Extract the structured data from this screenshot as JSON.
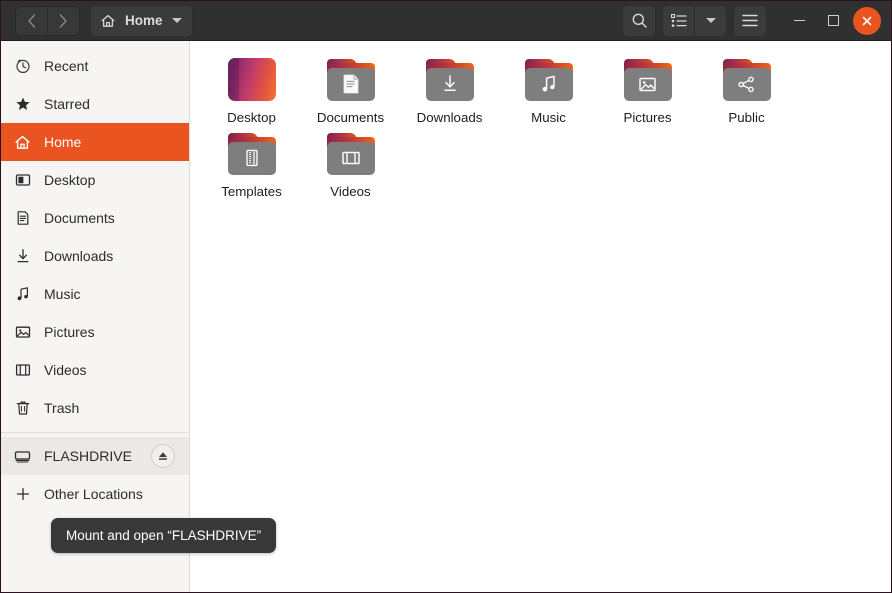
{
  "window": {
    "title": "Home",
    "titlebar": {
      "back_tooltip": "Back",
      "forward_tooltip": "Forward",
      "path_label": "Home",
      "path_icon": "home-icon",
      "search_icon": "search-icon",
      "view_list_icon": "list-view-icon",
      "view_dropdown_icon": "chevron-down-icon",
      "menu_icon": "hamburger-menu-icon",
      "minimize_label": "Minimize",
      "maximize_label": "Maximize",
      "close_label": "Close"
    },
    "colors": {
      "titlebar_bg": "#303030",
      "accent": "#e95420",
      "sidebar_bg": "#f6f5f4",
      "content_bg": "#ffffff",
      "tooltip_bg": "#383838"
    }
  },
  "sidebar": {
    "items": [
      {
        "label": "Recent",
        "icon": "clock-icon",
        "selected": false
      },
      {
        "label": "Starred",
        "icon": "star-icon",
        "selected": false
      },
      {
        "label": "Home",
        "icon": "home-icon",
        "selected": true
      },
      {
        "label": "Desktop",
        "icon": "desktop-icon",
        "selected": false
      },
      {
        "label": "Documents",
        "icon": "document-icon",
        "selected": false
      },
      {
        "label": "Downloads",
        "icon": "download-icon",
        "selected": false
      },
      {
        "label": "Music",
        "icon": "music-note-icon",
        "selected": false
      },
      {
        "label": "Pictures",
        "icon": "image-icon",
        "selected": false
      },
      {
        "label": "Videos",
        "icon": "film-icon",
        "selected": false
      },
      {
        "label": "Trash",
        "icon": "trash-icon",
        "selected": false
      }
    ],
    "devices": [
      {
        "label": "FLASHDRIVE",
        "icon": "drive-icon",
        "eject_icon": "eject-icon",
        "hovered": true
      }
    ],
    "other": {
      "label": "Other Locations",
      "icon": "plus-icon"
    }
  },
  "files": {
    "items": [
      {
        "name": "Desktop",
        "icon": "desktop-gradient-icon",
        "emblem": "none"
      },
      {
        "name": "Documents",
        "icon": "folder-icon",
        "emblem": "document-emblem"
      },
      {
        "name": "Downloads",
        "icon": "folder-icon",
        "emblem": "download-emblem"
      },
      {
        "name": "Music",
        "icon": "folder-icon",
        "emblem": "music-emblem"
      },
      {
        "name": "Pictures",
        "icon": "folder-icon",
        "emblem": "image-emblem"
      },
      {
        "name": "Public",
        "icon": "folder-icon",
        "emblem": "share-emblem"
      },
      {
        "name": "Templates",
        "icon": "folder-icon",
        "emblem": "template-emblem"
      },
      {
        "name": "Videos",
        "icon": "folder-icon",
        "emblem": "film-emblem"
      }
    ]
  },
  "tooltip": {
    "text": "Mount and open “FLASHDRIVE”"
  }
}
